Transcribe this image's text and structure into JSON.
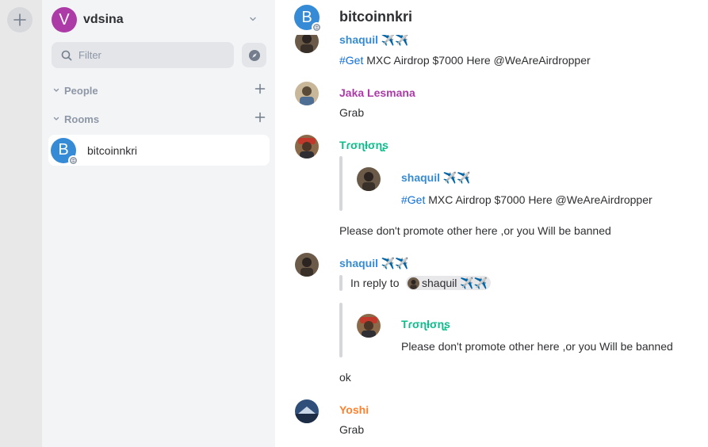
{
  "account": {
    "initial": "V",
    "name": "vdsina"
  },
  "filter": {
    "placeholder": "Filter"
  },
  "sections": {
    "people": "People",
    "rooms": "Rooms"
  },
  "rooms": [
    {
      "initial": "B",
      "name": "bitcoinnkri"
    }
  ],
  "header": {
    "initial": "B",
    "title": "bitcoinnkri"
  },
  "colors": {
    "account_avatar": "#ac3ba8",
    "room_avatar": "#368bd6",
    "shaquil": "#368bd6",
    "jaka": "#ac3ba8",
    "trontons": "#0dbd8b",
    "yoshi": "#ff812d",
    "hashtag": "#0d6ed9"
  },
  "messages": [
    {
      "sender": "shaquil ✈️✈️",
      "hashtag": "#Get",
      "text": " MXC Airdrop $7000 Here @WeAreAirdropper"
    },
    {
      "sender": "Jaka Lesmana",
      "text": "Grab"
    },
    {
      "sender": "Tɾσɳƚσɳʂ",
      "quote": {
        "sender": "shaquil ✈️✈️",
        "hashtag": "#Get",
        "text": " MXC Airdrop $7000 Here @WeAreAirdropper"
      },
      "text": "Please don't promote other here ,or you Will be banned"
    },
    {
      "sender": "shaquil ✈️✈️",
      "reply_prefix": "In reply to",
      "reply_user": "shaquil ✈️✈️",
      "quote": {
        "sender": "Tɾσɳƚσɳʂ",
        "text": "Please don't promote other here ,or you Will be banned"
      },
      "text": "ok"
    },
    {
      "sender": "Yoshi",
      "text": "Grab"
    }
  ]
}
